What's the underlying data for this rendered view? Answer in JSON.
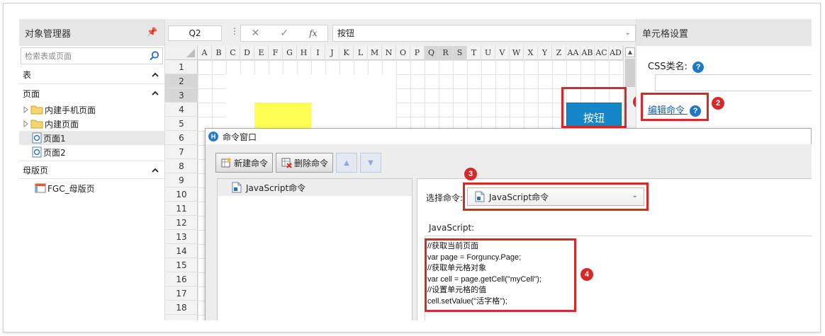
{
  "object_manager": {
    "title": "对象管理器",
    "search_placeholder": "检索表或页面",
    "sections": {
      "tables": "表",
      "pages": "页面",
      "master": "母版页"
    },
    "pages": [
      "内建手机页面",
      "内建页面",
      "页面1",
      "页面2"
    ],
    "master_items": [
      "FGC_母版页"
    ]
  },
  "formula_bar": {
    "cell_ref": "Q2",
    "formula_value": "按钮",
    "fx_label": "fx"
  },
  "grid": {
    "columns": [
      "A",
      "B",
      "C",
      "D",
      "E",
      "F",
      "G",
      "H",
      "I",
      "J",
      "K",
      "L",
      "M",
      "N",
      "O",
      "P",
      "Q",
      "R",
      "S",
      "T",
      "U",
      "V",
      "W",
      "X",
      "Y",
      "Z",
      "AA",
      "AB",
      "AC",
      "AD"
    ],
    "selected_columns": [
      "Q",
      "R",
      "S"
    ],
    "rows": [
      "1",
      "2",
      "3",
      "4",
      "5",
      "6",
      "7",
      "8",
      "9",
      "10",
      "11",
      "12",
      "13",
      "14",
      "15",
      "16",
      "17",
      "18"
    ],
    "selected_rows": [
      "2",
      "3"
    ],
    "button_label": "按钮",
    "yellow_fill": "#ffff55",
    "button_color": "#1487c9"
  },
  "cell_settings": {
    "title": "单元格设置",
    "css_label": "CSS类名:",
    "edit_command_link": "编辑命令",
    "help_glyph": "?"
  },
  "command_window": {
    "title": "命令窗口",
    "logo_letter": "H",
    "new_command": "新建命令",
    "delete_command": "删除命令",
    "commands": [
      "JavaScript命令"
    ],
    "select_label": "选择命令:",
    "selected_command": "JavaScript命令",
    "js_label": "JavaScript:",
    "code_lines": [
      "//获取当前页面",
      "var page = Forguncy.Page;",
      "//获取单元格对象",
      "var cell = page.getCell(\"myCell\");",
      "//设置单元格的值",
      "cell.setValue(\"活字格\");"
    ]
  },
  "annotations": {
    "badges": [
      "1",
      "2",
      "3",
      "4"
    ],
    "color": "#d42a2a"
  }
}
